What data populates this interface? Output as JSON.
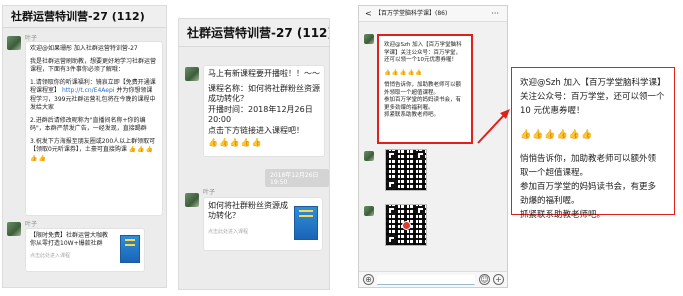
{
  "left_chat": {
    "title": "社群运营特训营-27 (112)",
    "sender": "叶子",
    "message": [
      "欢迎@如果珊彤 加入社群运营特训营-27",
      "我是社群运营刷助教，想要更好地学习社群运营课程，下面有3件事你必须了解哦：",
      "1.请领取你的听课福利：镜哀立即【免费开通课程课程室】",
      "http://t.cn/E4Aepi",
      "并为你想领课程学习，399元社群运营礼包将在今晚的课程中发给大家",
      "2.进群后请修改昵称为\"直播间名称+你的编码\"，本群严禁发广告，一经发现，直接踢群",
      "3.祝发下方海报至朋友圈或200人以上群领取可【领取0元听课券】，土豪可直接购课"
    ],
    "thumbs": "👍👍👍👍👍",
    "sender2": "叶子",
    "card_title": "【限时免费】社群运营大咖教你从零打造10W+爆款社群",
    "card_footer": "点击此处进入课程"
  },
  "mid_chat": {
    "title": "社群运营特训营-27 (112)",
    "message": [
      "马上有新课程要开播啦！！～～",
      "课程名称：如何将社群粉丝资源成功转化？",
      "开播时间：2018年12月26日 20:00",
      "点击下方链接进入课程吧！"
    ],
    "thumbs": "👍👍👍👍👍",
    "timestamp": "2018年12月26日 19:50",
    "sender": "叶子",
    "card_title": "如何将社群粉丝资源成功转化？",
    "card_footer": "点击此处进入课程"
  },
  "phone": {
    "header": "【百万学堂脑科学课】(86)",
    "back": "<",
    "more": "···",
    "message": [
      "欢迎@Szh 加入【百万学堂脑科学课】关注公众号：百万学堂，还可以领一个10元优惠券喔！",
      "👍👍👍👍👍",
      "悄悄告诉你，加助教老师可以额外领取一个超值课程。",
      "参加百万学堂的妈妈读书会，有更多劲爆的福利喔。",
      "抓紧联系助教老师吧。"
    ],
    "input_left": "⊕",
    "input_emoji": "☺",
    "input_plus": "+"
  },
  "zoom": {
    "line1": "欢迎@Szh 加入【百万学堂脑科学课】",
    "line2": "关注公众号：百万学堂，还可以领一个",
    "line3": "10 元优惠券喔！",
    "thumbs": "👍👍👍👍👍👍",
    "line4": "悄悄告诉你，加助教老师可以额外领",
    "line5": "取一个超值课程。",
    "line6": "参加百万学堂的妈妈读书会，有更多",
    "line7": "劲爆的福利喔。",
    "line8": "抓紧联系助教老师吧。"
  },
  "colors": {
    "highlight": "#e0201c",
    "link": "#2a6fc9",
    "bubble": "#ffffff",
    "chat_bg": "#ececec"
  }
}
